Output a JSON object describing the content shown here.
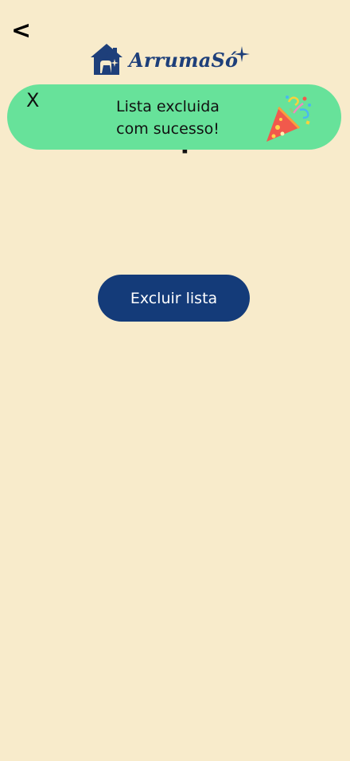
{
  "header": {
    "back_label": "<",
    "logo_text": "ArrumaSó"
  },
  "page": {
    "title_partial": "Compras"
  },
  "toast": {
    "close_label": "X",
    "message_line1": "Lista excluida",
    "message_line2": "com sucesso!",
    "icon": "party-popper-icon"
  },
  "actions": {
    "delete_list_label": "Excluir lista"
  },
  "colors": {
    "background": "#f8ebcb",
    "brand_blue": "#143b79",
    "toast_green": "#67e29a"
  }
}
